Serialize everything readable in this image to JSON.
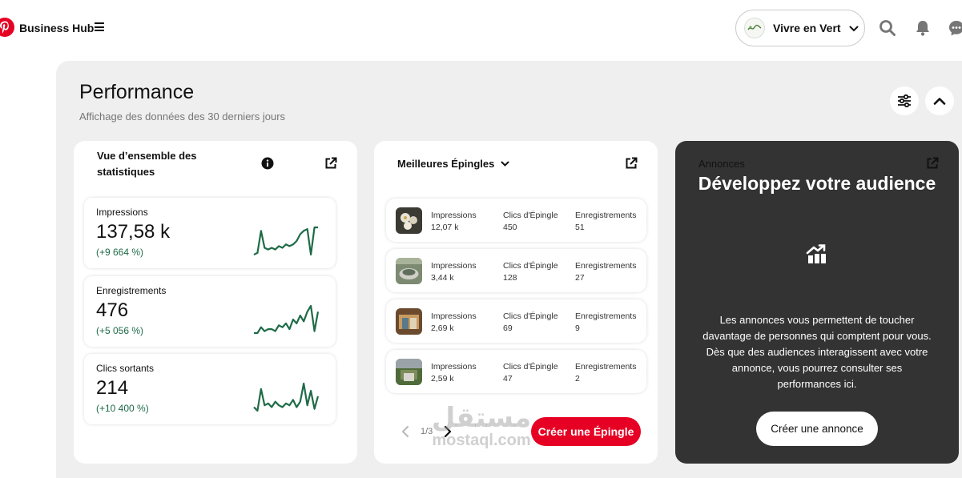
{
  "header": {
    "brand": "Business Hub",
    "account_name": "Vivre en Vert",
    "account_avatar_text": "Vivre en Vert"
  },
  "performance": {
    "title": "Performance",
    "subtitle": "Affichage des données des 30 derniers jours"
  },
  "overview": {
    "title": "Vue d’ensemble des statistiques",
    "stats": [
      {
        "label": "Impressions",
        "value": "137,58 k",
        "change": "(+9 664 %)",
        "series": [
          0,
          1,
          14,
          4,
          3,
          4,
          3,
          5,
          4,
          6,
          5,
          6,
          8,
          12,
          14,
          15,
          0,
          16,
          16
        ]
      },
      {
        "label": "Enregistrements",
        "value": "476",
        "change": "(+5 056 %)",
        "series": [
          0,
          0,
          3,
          1,
          2,
          2,
          1,
          4,
          3,
          5,
          2,
          7,
          5,
          9,
          6,
          11,
          14,
          1,
          11
        ]
      },
      {
        "label": "Clics sortants",
        "value": "214",
        "change": "(+10 400 %)",
        "series": [
          3,
          1,
          13,
          4,
          5,
          3,
          6,
          4,
          3,
          5,
          4,
          7,
          3,
          6,
          16,
          4,
          12,
          2,
          9
        ]
      }
    ]
  },
  "best_pins": {
    "title": "Meilleures Épingles",
    "col_labels": [
      "Impressions",
      "Clics d'Épingle",
      "Enregistrements"
    ],
    "rows": [
      {
        "impressions": "12,07 k",
        "clicks": "450",
        "saves": "51"
      },
      {
        "impressions": "3,44 k",
        "clicks": "128",
        "saves": "27"
      },
      {
        "impressions": "2,69 k",
        "clicks": "69",
        "saves": "9"
      },
      {
        "impressions": "2,59 k",
        "clicks": "47",
        "saves": "2"
      }
    ],
    "pager": "1/3",
    "create_pin": "Créer une Épingle"
  },
  "ads": {
    "title": "Annonces",
    "headline": "Développez votre audience",
    "body": "Les annonces vous permettent de toucher davantage de personnes qui comptent pour vous. Dès que des audiences interagissent avec votre annonce, vous pourrez consulter ses performances ici.",
    "cta": "Créer une annonce"
  },
  "watermark": {
    "arabic": "مستقل",
    "latin": "mostaql.com"
  },
  "colors": {
    "brand_red": "#e60023",
    "spark_green": "#1e6b47",
    "dark_card": "#333333",
    "panel_bg": "#efefef"
  },
  "icons": [
    "pinterest-logo-icon",
    "hamburger-menu-icon",
    "chevron-down-icon",
    "search-icon",
    "bell-icon",
    "chat-icon",
    "filter-icon",
    "chevron-up-icon",
    "info-icon",
    "external-link-icon",
    "chevron-left-icon",
    "chevron-right-icon",
    "chart-growth-icon"
  ]
}
